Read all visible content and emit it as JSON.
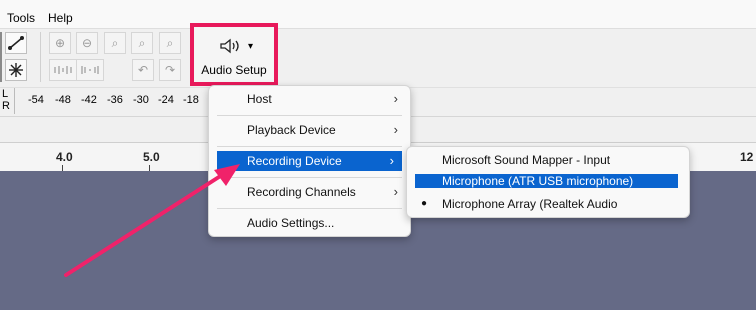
{
  "menubar": {
    "items": [
      "Tools",
      "Help"
    ]
  },
  "toolbar": {
    "audio_setup_label": "Audio Setup",
    "audio_setup_icon": "speaker-icon",
    "dropdown_glyph": "▾"
  },
  "meter": {
    "channels": [
      "L",
      "R"
    ],
    "ticks": [
      "-54",
      "-48",
      "-42",
      "-36",
      "-30",
      "-24",
      "-18"
    ]
  },
  "ruler": {
    "labels": [
      "4.0",
      "5.0",
      "12"
    ]
  },
  "audio_setup_menu": {
    "items": [
      "Host",
      "Playback Device",
      "Recording Device",
      "Recording Channels",
      "Audio Settings..."
    ],
    "selected": "Recording Device",
    "submenu_arrow": "›"
  },
  "recording_device_submenu": {
    "items": [
      "Microsoft Sound Mapper - Input",
      "Microphone (ATR USB microphone)",
      "Microphone Array (Realtek Audio"
    ],
    "highlighted": "Microphone (ATR USB microphone)",
    "checked": "Microphone Array (Realtek Audio"
  },
  "colors": {
    "highlight_border": "#e8195b",
    "annotation_arrow": "#f0226a",
    "menu_selection": "#0a64cf",
    "track_background": "#656a86"
  }
}
